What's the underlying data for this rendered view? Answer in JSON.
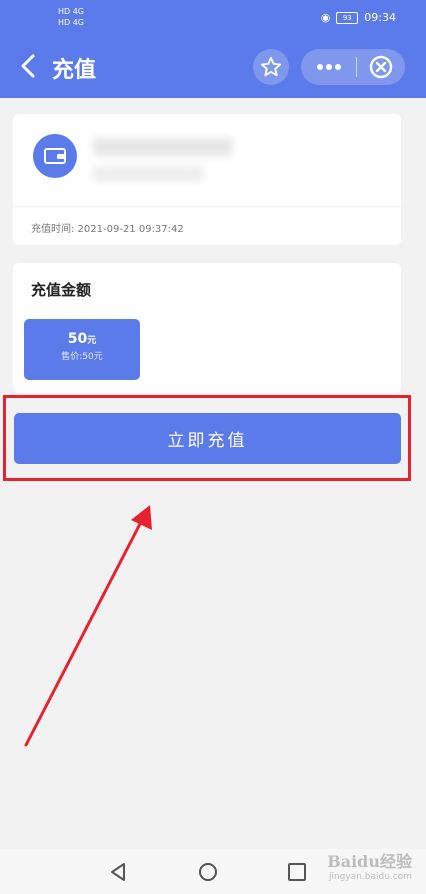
{
  "status_bar": {
    "network_line1": "HD 4G",
    "network_line2": "HD 4G",
    "time": "09:34",
    "battery": "93"
  },
  "header": {
    "title": "充值",
    "back_icon": "chevron-left-icon",
    "star_icon": "star-icon",
    "more_icon": "more-dots-icon",
    "close_icon": "close-circle-icon"
  },
  "account_card": {
    "wallet_icon": "wallet-icon",
    "recharge_time": "充值时间: 2021-09-21 09:37:42"
  },
  "amount_card": {
    "title": "充值金额",
    "options": [
      {
        "amount": "50",
        "unit": "元",
        "price": "售价:50元"
      }
    ]
  },
  "actions": {
    "recharge_now": "立即充值"
  },
  "annotation": {
    "highlight_color": "#e5222f",
    "arrow_color": "#e5222f"
  },
  "nav_bar": {
    "back_icon": "triangle-back-icon",
    "home_icon": "circle-home-icon",
    "recent_icon": "square-recent-icon"
  },
  "watermark": {
    "text": "Baidu经验",
    "sub": "jingyan.baidu.com"
  },
  "colors": {
    "primary": "#5b7bea",
    "background": "#f2f2f2"
  }
}
